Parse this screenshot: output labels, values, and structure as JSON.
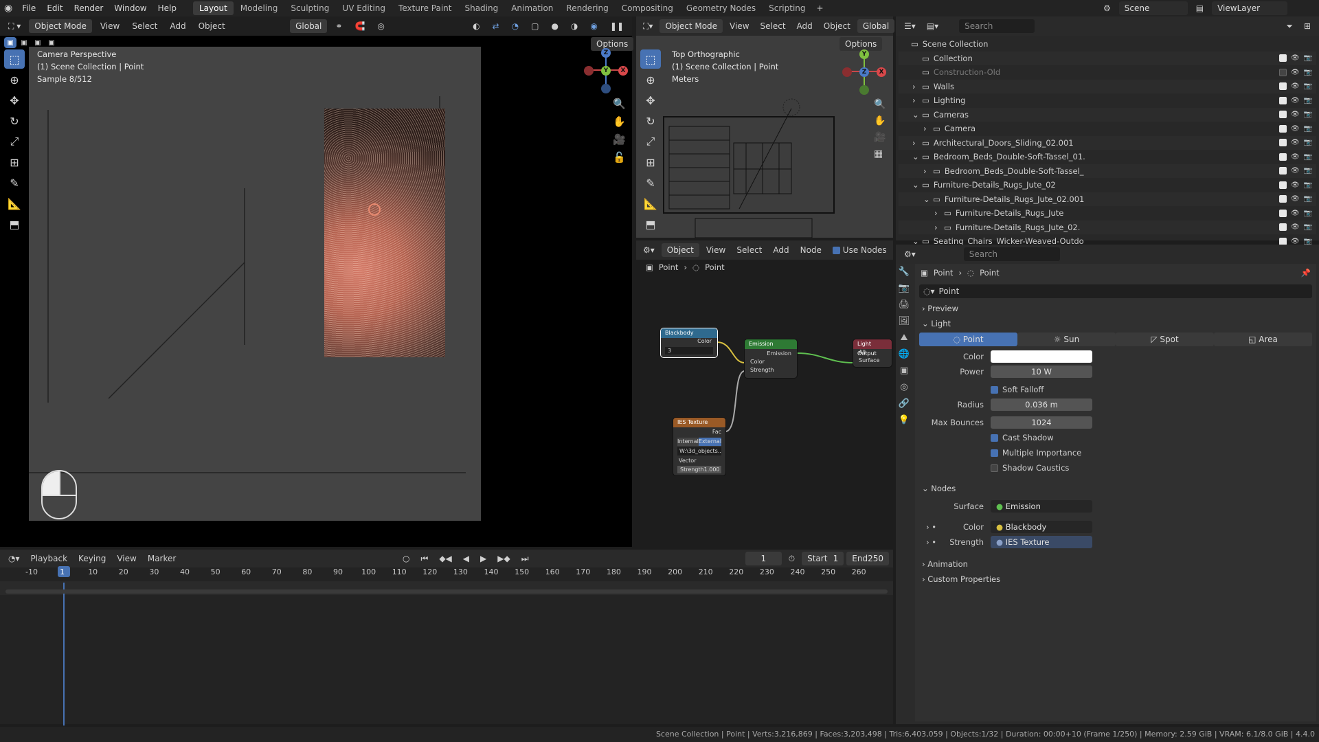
{
  "menubar": {
    "items": [
      "File",
      "Edit",
      "Render",
      "Window",
      "Help"
    ],
    "workspaces": [
      "Layout",
      "Modeling",
      "Sculpting",
      "UV Editing",
      "Texture Paint",
      "Shading",
      "Animation",
      "Rendering",
      "Compositing",
      "Geometry Nodes",
      "Scripting"
    ],
    "active_workspace": "Layout",
    "scene": "Scene",
    "view_layer": "ViewLayer"
  },
  "viewport_left": {
    "mode": "Object Mode",
    "menus": [
      "View",
      "Select",
      "Add",
      "Object"
    ],
    "transform": "Global",
    "options": "Options",
    "overlay_lines": [
      "Camera Perspective",
      "(1) Scene Collection | Point",
      "Sample 8/512"
    ]
  },
  "viewport_right": {
    "mode": "Object Mode",
    "menus": [
      "View",
      "Select",
      "Add",
      "Object"
    ],
    "transform": "Global",
    "options": "Options",
    "overlay_lines": [
      "Top Orthographic",
      "(1) Scene Collection | Point",
      "Meters"
    ]
  },
  "gizmo": {
    "x": "X",
    "y": "Y",
    "z": "Z"
  },
  "node_editor": {
    "type": "Object",
    "menus": [
      "View",
      "Select",
      "Add",
      "Node"
    ],
    "use_nodes": "Use Nodes",
    "breadcrumb": [
      "Point",
      "Point"
    ],
    "nodes": {
      "blackbody": {
        "title": "Blackbody",
        "out": "Color",
        "value": "3"
      },
      "emission": {
        "title": "Emission",
        "out": "Emission",
        "in1": "Color",
        "in2": "Strength"
      },
      "light_output": {
        "title": "Light Output",
        "target": "All",
        "in": "Surface"
      },
      "ies": {
        "title": "IES Texture",
        "out": "Fac",
        "mode_a": "Internal",
        "mode_b": "External",
        "path": "W:\\3d_objects...",
        "vector": "Vector",
        "strength_label": "Strength",
        "strength": "1.000"
      }
    }
  },
  "outliner": {
    "search": "Search",
    "rows": [
      {
        "label": "Scene Collection",
        "indent": 0,
        "exp": "",
        "vis": false
      },
      {
        "label": "Collection",
        "indent": 1,
        "exp": "",
        "vis": true
      },
      {
        "label": "Construction-Old",
        "indent": 1,
        "exp": "",
        "vis": true,
        "dim": true
      },
      {
        "label": "Walls",
        "indent": 1,
        "exp": "›",
        "vis": true
      },
      {
        "label": "Lighting",
        "indent": 1,
        "exp": "›",
        "vis": true
      },
      {
        "label": "Cameras",
        "indent": 1,
        "exp": "⌄",
        "vis": true
      },
      {
        "label": "Camera",
        "indent": 2,
        "exp": "›",
        "vis": true
      },
      {
        "label": "Architectural_Doors_Sliding_02.001",
        "indent": 1,
        "exp": "›",
        "vis": true
      },
      {
        "label": "Bedroom_Beds_Double-Soft-Tassel_01.",
        "indent": 1,
        "exp": "⌄",
        "vis": true
      },
      {
        "label": "Bedroom_Beds_Double-Soft-Tassel_",
        "indent": 2,
        "exp": "›",
        "vis": true
      },
      {
        "label": "Furniture-Details_Rugs_Jute_02",
        "indent": 1,
        "exp": "⌄",
        "vis": true
      },
      {
        "label": "Furniture-Details_Rugs_Jute_02.001",
        "indent": 2,
        "exp": "⌄",
        "vis": true
      },
      {
        "label": "Furniture-Details_Rugs_Jute",
        "indent": 3,
        "exp": "›",
        "vis": true
      },
      {
        "label": "Furniture-Details_Rugs_Jute_02.",
        "indent": 3,
        "exp": "›",
        "vis": true
      },
      {
        "label": "Seating_Chairs_Wicker-Weaved-Outdo",
        "indent": 1,
        "exp": "⌄",
        "vis": true
      }
    ]
  },
  "properties": {
    "search": "Search",
    "breadcrumb": [
      "Point",
      "Point"
    ],
    "datablock": "Point",
    "sections": {
      "preview": "Preview",
      "light": "Light",
      "nodes": "Nodes",
      "animation": "Animation",
      "custom": "Custom Properties"
    },
    "light_types": [
      "Point",
      "Sun",
      "Spot",
      "Area"
    ],
    "active_type": "Point",
    "color_label": "Color",
    "color_value": "#ffffff",
    "power_label": "Power",
    "power": "10 W",
    "soft_falloff": "Soft Falloff",
    "radius_label": "Radius",
    "radius": "0.036 m",
    "bounces_label": "Max Bounces",
    "bounces": "1024",
    "cast_shadow": "Cast Shadow",
    "multiple_importance": "Multiple Importance",
    "shadow_caustics": "Shadow Caustics",
    "surface_label": "Surface",
    "surface": "Emission",
    "ncolor_label": "Color",
    "ncolor": "Blackbody",
    "strength_label": "Strength",
    "strength": "IES Texture"
  },
  "timeline": {
    "menus": [
      "Playback",
      "Keying",
      "View",
      "Marker"
    ],
    "current": "1",
    "start_label": "Start",
    "start": "1",
    "end_label": "End",
    "end": "250",
    "ticks": [
      "-10",
      "1",
      "10",
      "20",
      "30",
      "40",
      "50",
      "60",
      "70",
      "80",
      "90",
      "100",
      "110",
      "120",
      "130",
      "140",
      "150",
      "160",
      "170",
      "180",
      "190",
      "200",
      "210",
      "220",
      "230",
      "240",
      "250",
      "260"
    ]
  },
  "statusbar": {
    "text": "Scene Collection | Point | Verts:3,216,869 | Faces:3,203,498 | Tris:6,403,059 | Objects:1/32 | Duration: 00:00+10 (Frame 1/250) | Memory: 2.59 GiB | VRAM: 6.1/8.0 GiB | 4.4.0"
  }
}
